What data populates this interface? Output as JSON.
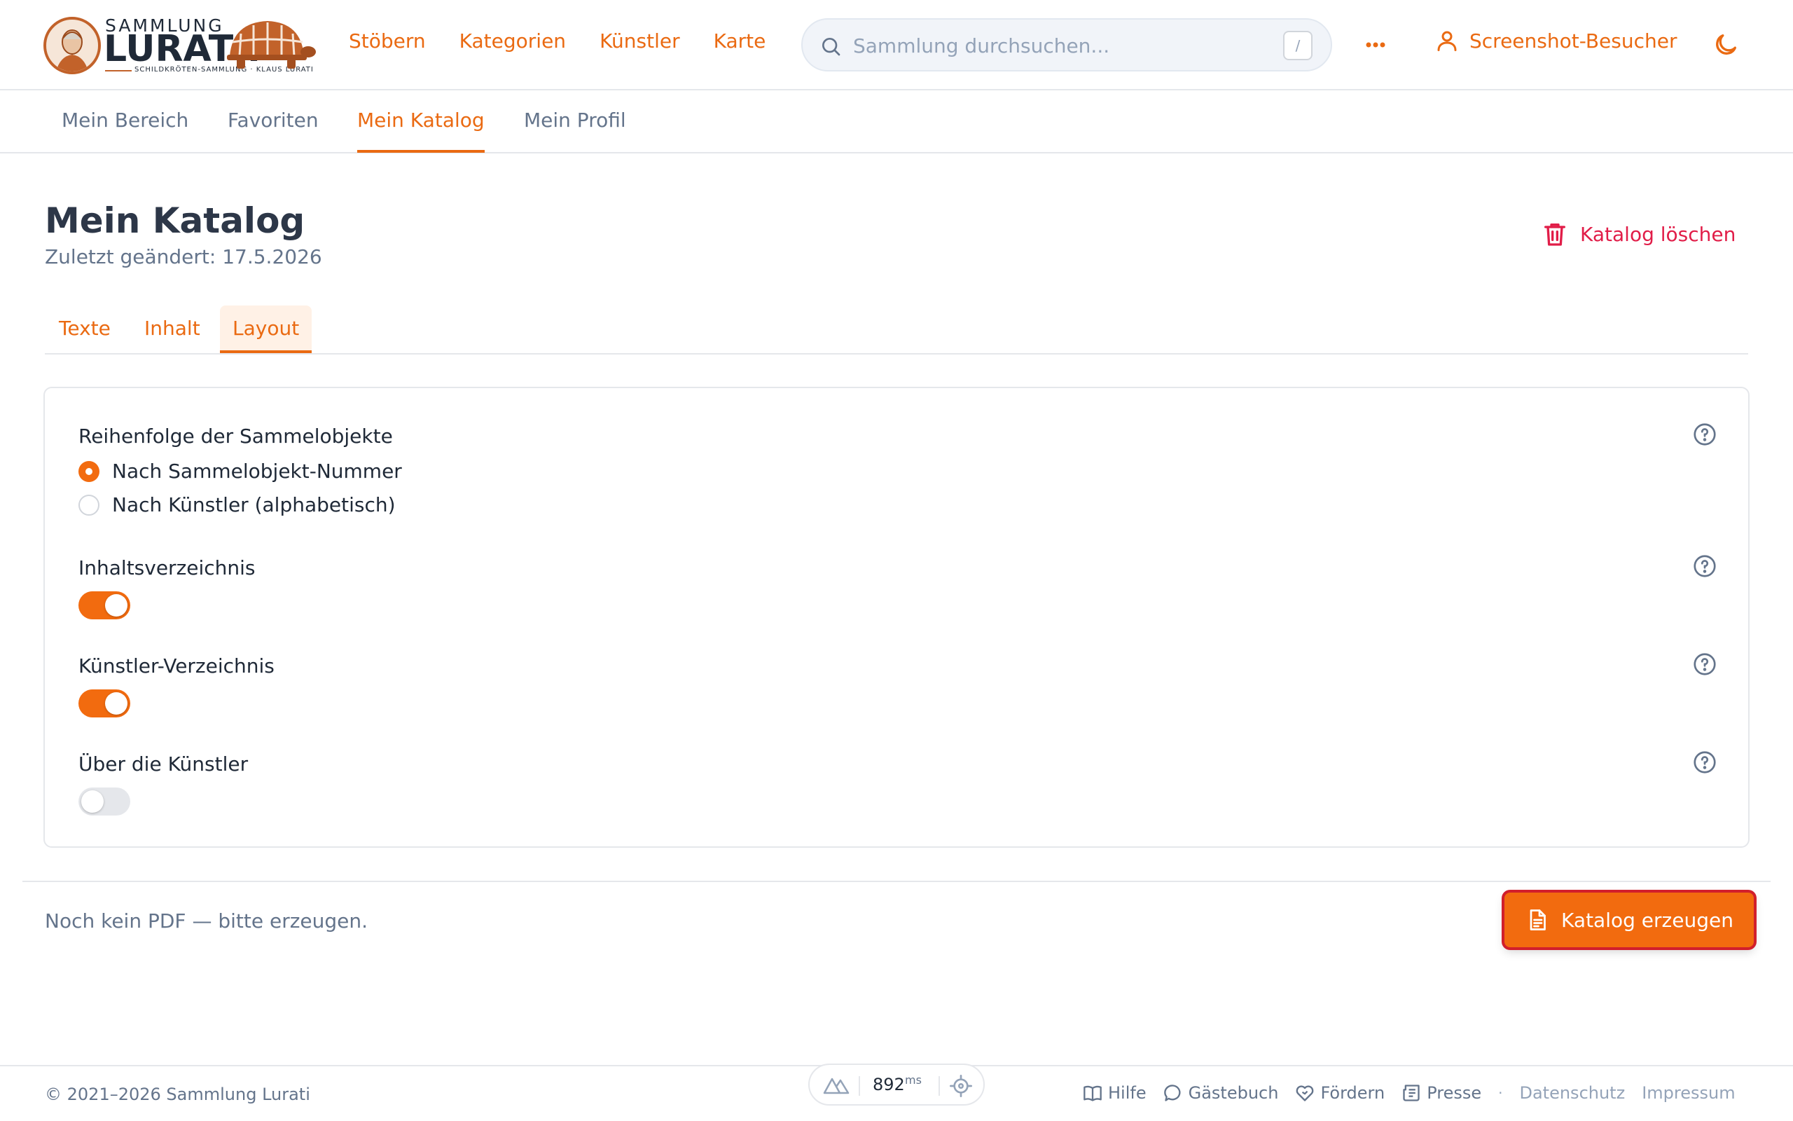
{
  "brand": {
    "top": "SAMMLUNG",
    "name": "LURATI.",
    "tagline": "SCHILDKRÖTEN-SAMMLUNG · KLAUS LURATI"
  },
  "header": {
    "nav": [
      "Stöbern",
      "Kategorien",
      "Künstler",
      "Karte"
    ],
    "search_placeholder": "Sammlung durchsuchen...",
    "search_shortcut": "/",
    "user_name": "Screenshot-Besucher",
    "accent": "#ea6a12"
  },
  "subnav": {
    "items": [
      "Mein Bereich",
      "Favoriten",
      "Mein Katalog",
      "Mein Profil"
    ],
    "active": "Mein Katalog"
  },
  "page": {
    "title": "Mein Katalog",
    "last_changed": "Zuletzt geändert: 17.5.2026",
    "delete_label": "Katalog löschen",
    "danger_color": "#e11d48"
  },
  "tabs": {
    "items": [
      "Texte",
      "Inhalt",
      "Layout"
    ],
    "active": "Layout"
  },
  "layout_settings": {
    "order": {
      "label": "Reihenfolge der Sammelobjekte",
      "options": [
        "Nach Sammelobjekt-Nummer",
        "Nach Künstler (alphabetisch)"
      ],
      "selected": "Nach Sammelobjekt-Nummer"
    },
    "toc": {
      "label": "Inhaltsverzeichnis",
      "enabled": true
    },
    "artist_index": {
      "label": "Künstler-Verzeichnis",
      "enabled": true
    },
    "about_artists": {
      "label": "Über die Künstler",
      "enabled": false
    }
  },
  "actions": {
    "pdf_status": "Noch kein PDF — bitte erzeugen.",
    "generate_label": "Katalog erzeugen"
  },
  "footer": {
    "copyright": "© 2021–2026 Sammlung Lurati",
    "perf_value": "892",
    "perf_unit": "ms",
    "links": [
      "Hilfe",
      "Gästebuch",
      "Fördern",
      "Presse"
    ],
    "legal": [
      "Datenschutz",
      "Impressum"
    ]
  }
}
